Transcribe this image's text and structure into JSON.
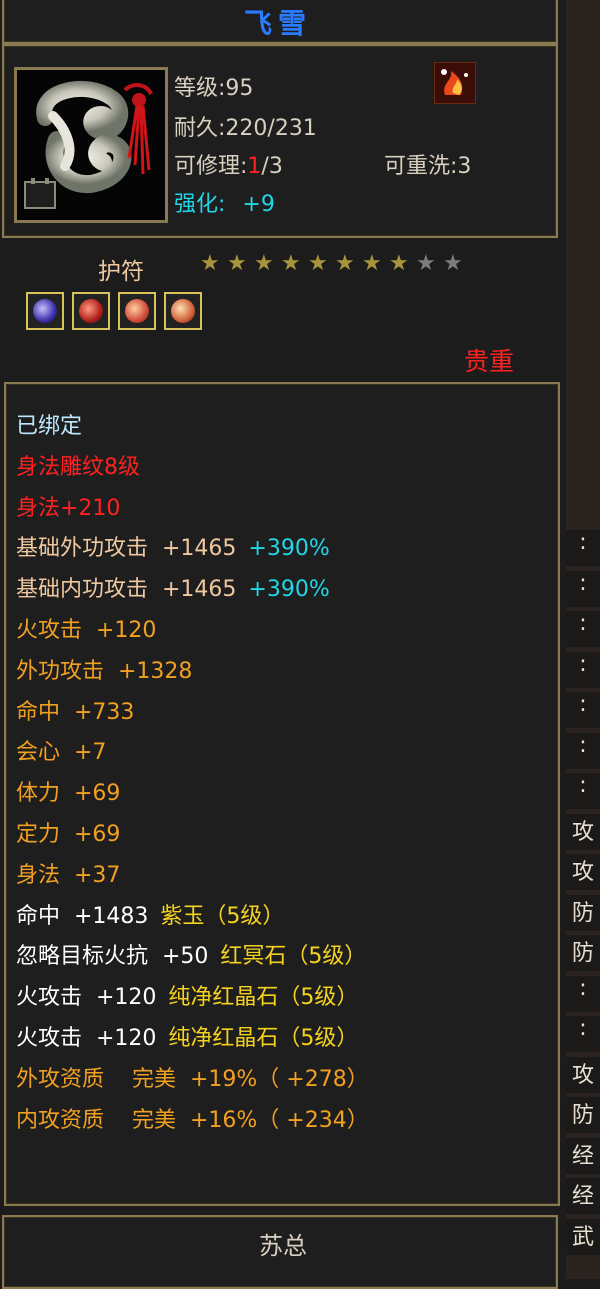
{
  "item": {
    "name": "飞雪",
    "level_line": "等级:95",
    "durability_line": "耐久:220/231",
    "repair_label": "可修理:",
    "repair_current": "1",
    "repair_total": "/3",
    "rewash_line": "可重洗:3",
    "enhance_label": "强化:",
    "enhance_value": "+9",
    "type": "护符",
    "rarity": "贵重",
    "stars_total": 10,
    "stars_filled": 8,
    "owner": "苏总"
  },
  "stats": [
    {
      "text": "已绑定",
      "color": "pale"
    },
    {
      "text": "身法雕纹8级",
      "color": "red"
    },
    {
      "text": "身法+210",
      "color": "red"
    },
    {
      "text": "基础外功攻击  +1465",
      "extra": "+390%",
      "color": "peach"
    },
    {
      "text": "基础内功攻击  +1465",
      "extra": "+390%",
      "color": "peach"
    },
    {
      "text": "火攻击  +120",
      "color": "orange"
    },
    {
      "text": "外功攻击  +1328",
      "color": "orange"
    },
    {
      "text": "命中  +733",
      "color": "orange"
    },
    {
      "text": "会心  +7",
      "color": "orange"
    },
    {
      "text": "体力  +69",
      "color": "orange"
    },
    {
      "text": "定力  +69",
      "color": "orange"
    },
    {
      "text": "身法  +37",
      "color": "orange"
    },
    {
      "text": "命中  +1483",
      "extra": "紫玉（5级）",
      "color": "white"
    },
    {
      "text": "忽略目标火抗  +50",
      "extra": "红冥石（5级）",
      "color": "white"
    },
    {
      "text": "火攻击  +120",
      "extra": "纯净红晶石（5级）",
      "color": "white"
    },
    {
      "text": "火攻击  +120",
      "extra": "纯净红晶石（5级）",
      "color": "white"
    },
    {
      "text": "外攻资质    完美  +19%（ +278）",
      "color": "orange"
    },
    {
      "text": "内攻资质    完美  +16%（ +234）",
      "color": "orange"
    }
  ],
  "right_panel": [
    ":",
    ":",
    ":",
    ":",
    ":",
    ":",
    ":",
    "攻",
    "攻",
    "防",
    "防",
    ":",
    ":",
    "攻",
    "防",
    "经",
    "经",
    "武"
  ]
}
